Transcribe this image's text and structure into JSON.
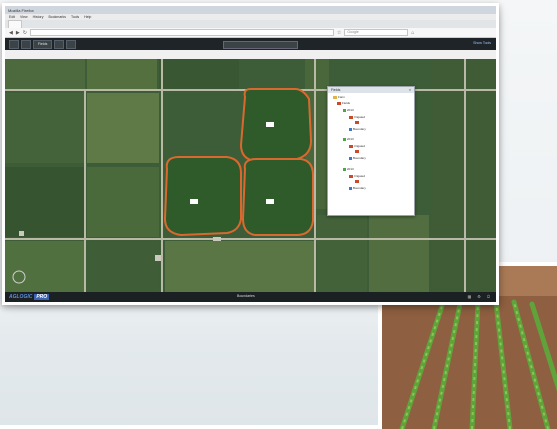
{
  "browser": {
    "title": "Mozilla Firefox",
    "menu": [
      "Edit",
      "View",
      "History",
      "Bookmarks",
      "Tools",
      "Help"
    ],
    "tab_label": "",
    "url": "",
    "search_placeholder": "Google"
  },
  "app": {
    "toolbar_buttons": [
      "",
      "",
      "Fields",
      "",
      ""
    ],
    "layer_label": "",
    "layer_value": "",
    "right_action": "Show Tools"
  },
  "tree": {
    "header": "Fields",
    "rows": [
      "Farm",
      "Fields",
      "2013",
      "Irrigated",
      "",
      "Boundary",
      "2013",
      "Irrigated",
      "",
      "Boundary",
      "2013",
      "Irrigated",
      "",
      "Boundary"
    ]
  },
  "map": {
    "pivot_labels": [
      "",
      "",
      ""
    ]
  },
  "statusbar": {
    "brand": "AGLOGIC",
    "brand_suffix": "PRO",
    "center": "Boundaries"
  },
  "colors": {
    "pivot_outline": "#d9692e",
    "toolbar_bg": "#1e2427",
    "brand_blue": "#3a62b0"
  }
}
